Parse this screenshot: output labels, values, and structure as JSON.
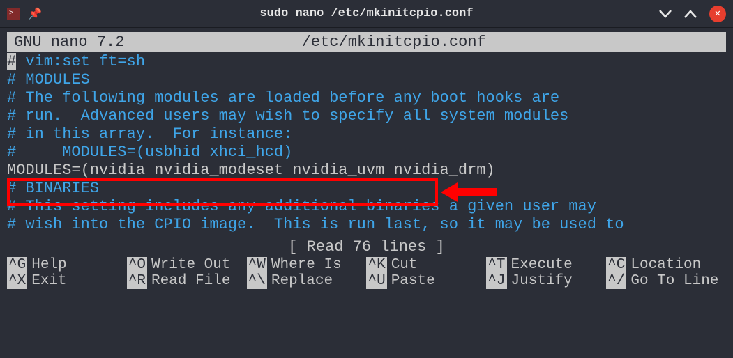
{
  "titlebar": {
    "title": "sudo nano /etc/mkinitcpio.conf"
  },
  "editor": {
    "name": "  GNU nano 7.2",
    "filepath": "/etc/mkinitcpio.conf"
  },
  "lines": {
    "l1_cursor": "#",
    "l1_rest": " vim:set ft=sh",
    "l2": "# MODULES",
    "l3": "# The following modules are loaded before any boot hooks are",
    "l4": "# run.  Advanced users may wish to specify all system modules",
    "l5": "# in this array.  For instance:",
    "l6": "#     MODULES=(usbhid xhci_hcd)",
    "l7": "MODULES=(nvidia nvidia_modeset nvidia_uvm nvidia_drm)",
    "l8": "",
    "l9": "# BINARIES",
    "l10": "# This setting includes any additional binaries a given user may",
    "l11": "# wish into the CPIO image.  This is run last, so it may be used to"
  },
  "status": "[ Read 76 lines ]",
  "shortcuts": {
    "row1": [
      {
        "key": "^G",
        "label": "Help"
      },
      {
        "key": "^O",
        "label": "Write Out"
      },
      {
        "key": "^W",
        "label": "Where Is"
      },
      {
        "key": "^K",
        "label": "Cut"
      },
      {
        "key": "^T",
        "label": "Execute"
      },
      {
        "key": "^C",
        "label": "Location"
      }
    ],
    "row2": [
      {
        "key": "^X",
        "label": "Exit"
      },
      {
        "key": "^R",
        "label": "Read File"
      },
      {
        "key": "^\\",
        "label": "Replace"
      },
      {
        "key": "^U",
        "label": "Paste"
      },
      {
        "key": "^J",
        "label": "Justify"
      },
      {
        "key": "^/",
        "label": "Go To Line"
      }
    ]
  }
}
